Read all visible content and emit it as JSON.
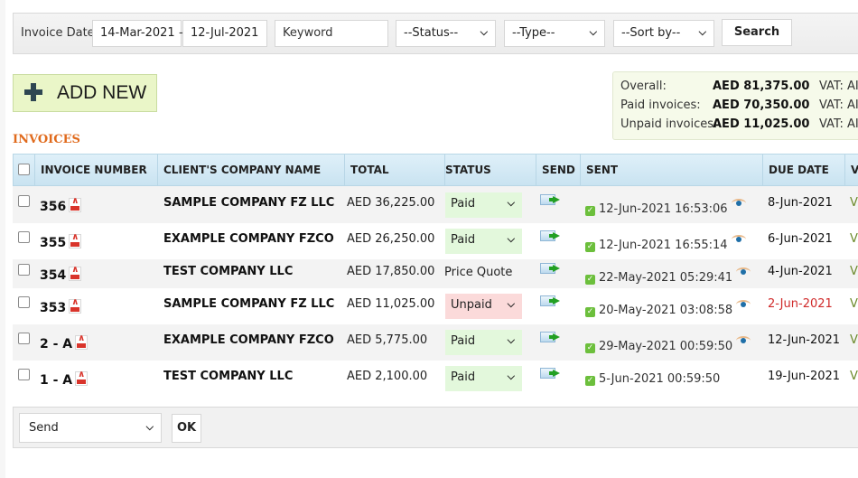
{
  "filters": {
    "invoice_date_label": "Invoice Date:",
    "date_from": "14-Mar-2021",
    "date_separator": "-",
    "date_to": "12-Jul-2021",
    "keyword_placeholder": "Keyword",
    "status_selected": "--Status--",
    "type_selected": "--Type--",
    "sort_selected": "--Sort by--",
    "search_label": "Search"
  },
  "add_new_label": "ADD NEW",
  "summary": {
    "rows": [
      {
        "label": "Overall:",
        "value": "AED 81,375.00",
        "vat": "VAT: AI"
      },
      {
        "label": "Paid invoices:",
        "value": "AED 70,350.00",
        "vat": "VAT: AI"
      },
      {
        "label": "Unpaid invoices:",
        "value": "AED 11,025.00",
        "vat": "VAT: AI"
      }
    ]
  },
  "section_title": "INVOICES",
  "table": {
    "columns": [
      "INVOICE NUMBER",
      "CLIENT'S COMPANY NAME",
      "TOTAL",
      "STATUS",
      "SEND",
      "SENT",
      "DUE DATE",
      "V"
    ],
    "rows": [
      {
        "number": "356",
        "company": "SAMPLE COMPANY FZ LLC",
        "total": "AED 36,225.00",
        "status": "Paid",
        "status_kind": "paid",
        "sent": "12-Jun-2021 16:53:06",
        "viewed": true,
        "due": "8-Jun-2021",
        "overdue": false,
        "v": "V"
      },
      {
        "number": "355",
        "company": "EXAMPLE COMPANY FZCO",
        "total": "AED 26,250.00",
        "status": "Paid",
        "status_kind": "paid",
        "sent": "12-Jun-2021 16:55:14",
        "viewed": true,
        "due": "6-Jun-2021",
        "overdue": false,
        "v": "V"
      },
      {
        "number": "354",
        "company": "TEST COMPANY LLC",
        "total": "AED 17,850.00",
        "status": "Price Quote",
        "status_kind": "quote",
        "sent": "22-May-2021 05:29:41",
        "viewed": true,
        "due": "4-Jun-2021",
        "overdue": false,
        "v": "V"
      },
      {
        "number": "353",
        "company": "SAMPLE COMPANY FZ LLC",
        "total": "AED 11,025.00",
        "status": "Unpaid",
        "status_kind": "unpaid",
        "sent": "20-May-2021 03:08:58",
        "viewed": true,
        "due": "2-Jun-2021",
        "overdue": true,
        "v": "V"
      },
      {
        "number": "2 - A",
        "company": "EXAMPLE COMPANY FZCO",
        "total": "AED 5,775.00",
        "status": "Paid",
        "status_kind": "paid",
        "sent": "29-May-2021 00:59:50",
        "viewed": true,
        "due": "12-Jun-2021",
        "overdue": false,
        "v": "V"
      },
      {
        "number": "1 - A",
        "company": "TEST COMPANY LLC",
        "total": "AED 2,100.00",
        "status": "Paid",
        "status_kind": "paid",
        "sent": "5-Jun-2021 00:59:50",
        "viewed": false,
        "due": "19-Jun-2021",
        "overdue": false,
        "v": "V"
      }
    ]
  },
  "bulk": {
    "action_selected": "Send",
    "ok_label": "OK"
  },
  "icons": {
    "chevron": "⌄",
    "check": "✓"
  }
}
